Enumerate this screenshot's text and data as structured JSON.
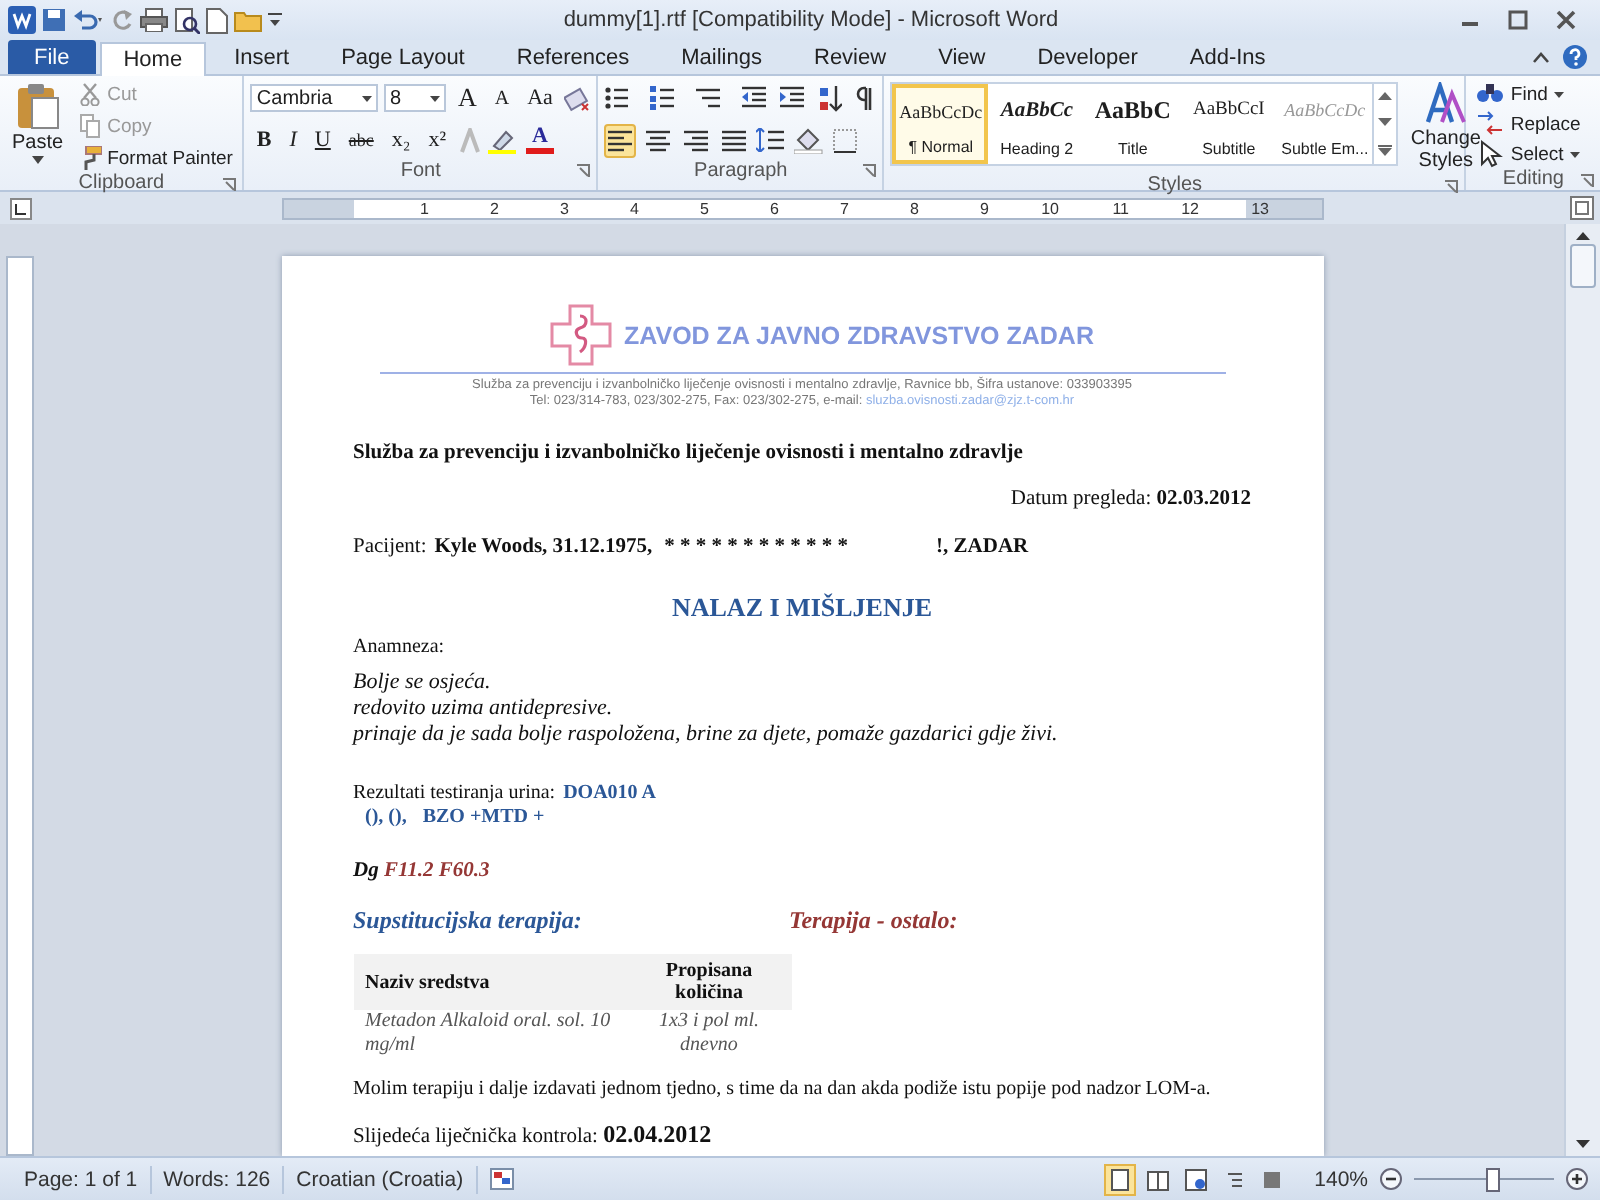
{
  "window": {
    "title": "dummy[1].rtf [Compatibility Mode] - Microsoft Word"
  },
  "tabs": [
    {
      "label": "File",
      "kind": "file",
      "selected": false
    },
    {
      "label": "Home",
      "kind": "plain",
      "selected": true
    },
    {
      "label": "Insert",
      "kind": "plain",
      "selected": false
    },
    {
      "label": "Page Layout",
      "kind": "plain",
      "selected": false
    },
    {
      "label": "References",
      "kind": "plain",
      "selected": false
    },
    {
      "label": "Mailings",
      "kind": "plain",
      "selected": false
    },
    {
      "label": "Review",
      "kind": "plain",
      "selected": false
    },
    {
      "label": "View",
      "kind": "plain",
      "selected": false
    },
    {
      "label": "Developer",
      "kind": "plain",
      "selected": false
    },
    {
      "label": "Add-Ins",
      "kind": "plain",
      "selected": false
    }
  ],
  "ribbon": {
    "clipboard": {
      "label": "Clipboard",
      "paste": "Paste",
      "items": [
        {
          "label": "Cut",
          "kind": "cut",
          "disabled": true
        },
        {
          "label": "Copy",
          "kind": "copy",
          "disabled": true
        },
        {
          "label": "Format Painter",
          "kind": "painter",
          "disabled": false
        }
      ]
    },
    "font": {
      "label": "Font",
      "font_name": "Cambria",
      "font_size": "8",
      "top_buttons": [
        {
          "label": "A",
          "kind": "grow"
        },
        {
          "label": "A",
          "kind": "shrink"
        },
        {
          "label": "Aa",
          "kind": "case"
        }
      ],
      "buttons": [
        {
          "label": "B",
          "kind": "bold"
        },
        {
          "label": "I",
          "kind": "italic"
        },
        {
          "label": "U",
          "kind": "underline"
        },
        {
          "label": "abc",
          "kind": "strike"
        },
        {
          "label": "x₂",
          "kind": "sub"
        },
        {
          "label": "x²",
          "kind": "sup"
        },
        {
          "label": "A",
          "kind": "color"
        }
      ]
    },
    "paragraph": {
      "label": "Paragraph",
      "alignments": [
        {
          "selected": true
        },
        {
          "selected": false
        },
        {
          "selected": false
        },
        {
          "selected": false
        }
      ]
    },
    "styles": {
      "label": "Styles",
      "items": [
        {
          "preview": "AaBbCcDc",
          "name": "¶ Normal",
          "kind": "normal",
          "selected": true
        },
        {
          "preview": "AaBbCc",
          "name": "Heading 2",
          "kind": "heading",
          "selected": false
        },
        {
          "preview": "AaBbC",
          "name": "Title",
          "kind": "title",
          "selected": false
        },
        {
          "preview": "AaBbCcI",
          "name": "Subtitle",
          "kind": "subtitle",
          "selected": false
        },
        {
          "preview": "AaBbCcDc",
          "name": "Subtle Em...",
          "kind": "subtle",
          "selected": false
        }
      ],
      "change_styles": "Change Styles"
    },
    "editing": {
      "label": "Editing",
      "items": [
        {
          "label": "Find",
          "kind": "find"
        },
        {
          "label": "Replace",
          "kind": "replace"
        },
        {
          "label": "Select",
          "kind": "select"
        }
      ]
    }
  },
  "ruler": {
    "marks": [
      "1",
      "2",
      "3",
      "4",
      "5",
      "6",
      "7",
      "8",
      "9",
      "10",
      "11",
      "12",
      "13"
    ]
  },
  "document": {
    "org": "ZAVOD ZA JAVNO ZDRAVSTVO ZADAR",
    "org_line_1": "Služba za prevenciju i izvanbolničko liječenje ovisnosti i mentalno zdravlje, Ravnice bb, Šifra ustanove: 033903395",
    "org_line_2": "Tel: 023/314-783, 023/302-275, Fax: 023/302-275, e-mail:",
    "email": "sluzba.ovisnosti.zadar@zjz.t-com.hr",
    "department": "Služba za prevenciju i izvanbolničko liječenje ovisnosti i mentalno zdravlje",
    "date_label": "Datum pregleda:",
    "date": "02.03.2012",
    "patient_label": "Pacijent:",
    "patient": "Kyle Woods, 31.12.1975,",
    "patient_redacted": "* * * * * * * * * * * *",
    "patient_city": "!, ZADAR",
    "heading": "NALAZ I MIŠLJENJE",
    "anamnesis_label": "Anamneza:",
    "anamnesis": [
      "Bolje se osjeća.",
      "redovito uzima antidepresive.",
      "prinaje da je sada bolje raspoložena, brine za djete, pomaže gazdarici gdje živi."
    ],
    "urine_label": "Rezultati testiranja urina:",
    "urine_result": "DOA010 A",
    "urine_line_2": [
      "(), (),",
      "BZO +MTD +"
    ],
    "dg_label": "Dg",
    "dg": "F11.2 F60.3",
    "therapy_substitution": "Supstitucijska  terapija:",
    "therapy_other": "Terapija - ostalo:",
    "table": {
      "columns": [
        "Naziv sredstva",
        "Propisana količina"
      ],
      "rows": [
        [
          "Metadon Alkaloid oral. sol. 10 mg/ml",
          "1x3 i pol ml. dnevno"
        ]
      ]
    },
    "note": "Molim terapiju i dalje izdavati jednom tjedno, s time da na dan akda podiže istu popije pod nadzor LOM-a.",
    "control_label": "Slijedeća liječnička kontrola:",
    "control_date": "02.04.2012"
  },
  "status_bar": {
    "items": [
      "Page: 1 of 1",
      "Words: 126",
      "Croatian (Croatia)"
    ],
    "views": [
      {
        "selected": true
      },
      {
        "selected": false
      },
      {
        "selected": false
      },
      {
        "selected": false
      },
      {
        "selected": false
      }
    ],
    "zoom": {
      "label": "140%",
      "level": 0.55
    }
  }
}
